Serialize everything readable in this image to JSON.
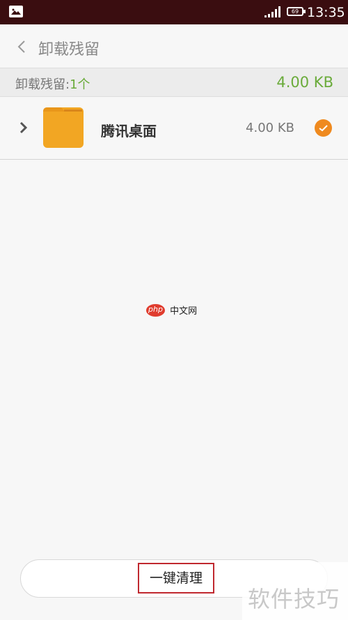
{
  "status_bar": {
    "time": "13:35",
    "battery": "69",
    "icons": [
      "gallery-icon",
      "signal-icon",
      "battery-icon"
    ]
  },
  "header": {
    "title": "卸载残留",
    "back_icon": "chevron-left-icon"
  },
  "summary": {
    "label": "卸载残留:",
    "count": "1个",
    "total_size": "4.00 KB"
  },
  "items": [
    {
      "name": "腾讯桌面",
      "size": "4.00 KB",
      "checked": true,
      "icon": "folder-icon"
    }
  ],
  "action": {
    "clean_label": "一键清理"
  },
  "watermarks": {
    "center_brand": "php",
    "center_text": "中文网",
    "corner_text": "软件技巧"
  },
  "colors": {
    "status_bar": "#3a0d10",
    "accent_green": "#6aab3a",
    "accent_orange": "#ef8a1f",
    "folder": "#f2a623",
    "highlight_red": "#c0282f"
  }
}
